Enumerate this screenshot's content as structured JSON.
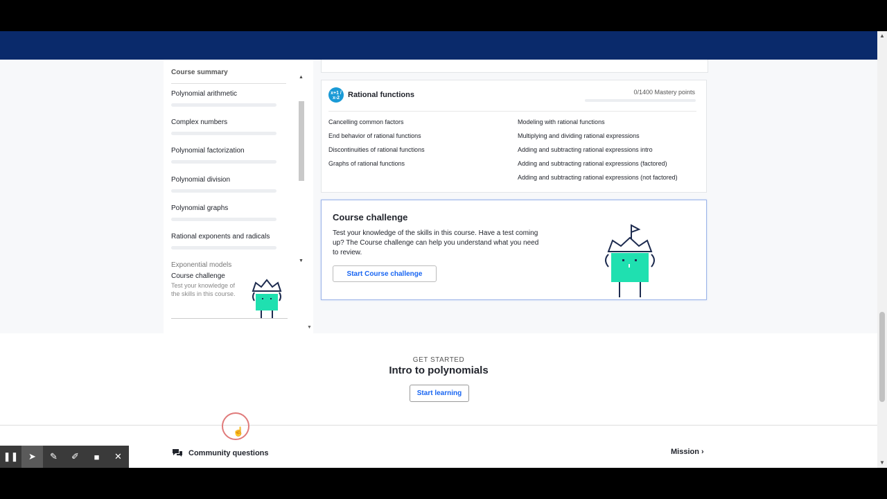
{
  "sidebar": {
    "header": "Course summary",
    "items": [
      {
        "label": "Polynomial arithmetic"
      },
      {
        "label": "Complex numbers"
      },
      {
        "label": "Polynomial factorization"
      },
      {
        "label": "Polynomial division"
      },
      {
        "label": "Polynomial graphs"
      },
      {
        "label": "Rational exponents and radicals"
      }
    ],
    "partial_item": "Exponential models",
    "challenge": {
      "title": "Course challenge",
      "desc": "Test your knowledge of the skills in this course."
    }
  },
  "unit": {
    "title": "Rational functions",
    "icon_text": "x+1 / x-2",
    "mastery": "0/1400 Mastery points",
    "mastery_fraction": 0,
    "left_skills": [
      "Cancelling common factors",
      "End behavior of rational functions",
      "Discontinuities of rational functions",
      "Graphs of rational functions"
    ],
    "right_skills": [
      "Modeling with rational functions",
      "Multiplying and dividing rational expressions",
      "Adding and subtracting rational expressions intro",
      "Adding and subtracting rational expressions (factored)",
      "Adding and subtracting rational expressions (not factored)"
    ]
  },
  "course_challenge": {
    "title": "Course challenge",
    "desc": "Test your knowledge of the skills in this course. Have a test coming up? The Course challenge can help you understand what you need to review.",
    "button": "Start Course challenge"
  },
  "get_started": {
    "kicker": "GET STARTED",
    "title": "Intro to polynomials",
    "button": "Start learning"
  },
  "footer": {
    "community": "Community questions",
    "mission": "Mission"
  },
  "toolbar": [
    "pause-icon",
    "pointer-icon",
    "pen-icon",
    "highlighter-icon",
    "camera-icon",
    "close-icon"
  ],
  "colors": {
    "navbar": "#0a2a6b",
    "accent": "#1865f2",
    "mascot": "#1fe0b0"
  }
}
